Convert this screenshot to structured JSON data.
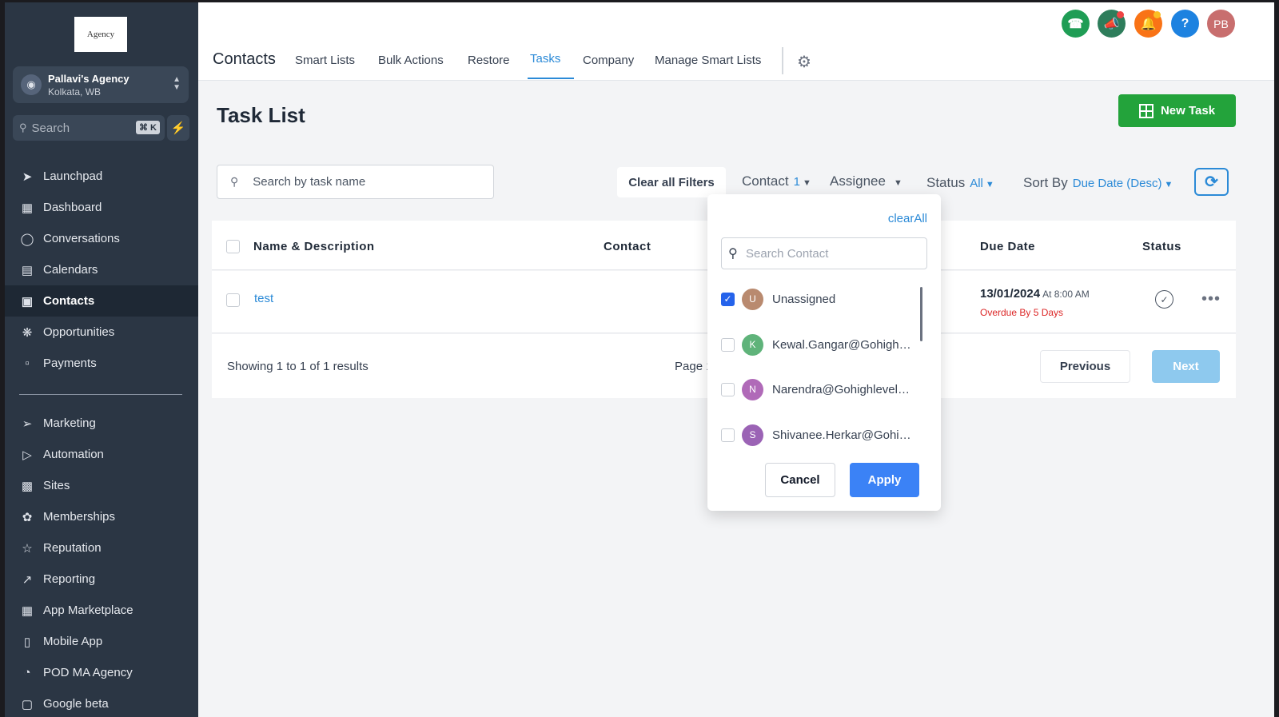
{
  "brand": {
    "logo_text": "Agency"
  },
  "account": {
    "name": "Pallavi's Agency",
    "location": "Kolkata, WB"
  },
  "sidebar_search": {
    "placeholder": "Search",
    "shortcut": "⌘ K"
  },
  "sidebar": {
    "items": [
      {
        "label": "Launchpad",
        "icon": "rocket-icon"
      },
      {
        "label": "Dashboard",
        "icon": "grid-icon"
      },
      {
        "label": "Conversations",
        "icon": "chat-icon"
      },
      {
        "label": "Calendars",
        "icon": "calendar-icon"
      },
      {
        "label": "Contacts",
        "icon": "contacts-icon",
        "active": true
      },
      {
        "label": "Opportunities",
        "icon": "opportunities-icon"
      },
      {
        "label": "Payments",
        "icon": "receipt-icon"
      },
      {
        "label": "Marketing",
        "icon": "send-icon"
      },
      {
        "label": "Automation",
        "icon": "automation-icon"
      },
      {
        "label": "Sites",
        "icon": "globe-icon"
      },
      {
        "label": "Memberships",
        "icon": "badge-icon"
      },
      {
        "label": "Reputation",
        "icon": "star-icon"
      },
      {
        "label": "Reporting",
        "icon": "trend-icon"
      },
      {
        "label": "App Marketplace",
        "icon": "apps-icon"
      },
      {
        "label": "Mobile App",
        "icon": "phone-icon"
      },
      {
        "label": "POD MA Agency",
        "icon": "pie-icon"
      },
      {
        "label": "Google beta",
        "icon": "google-icon"
      }
    ]
  },
  "header": {
    "title": "Contacts",
    "tabs": [
      {
        "label": "Smart Lists"
      },
      {
        "label": "Bulk Actions"
      },
      {
        "label": "Restore"
      },
      {
        "label": "Tasks",
        "active": true
      },
      {
        "label": "Company"
      },
      {
        "label": "Manage Smart Lists"
      }
    ],
    "avatar_initials": "PB",
    "help_glyph": "?",
    "colors": {
      "phone": "#1f9d55",
      "announce": "#2e7d5b",
      "bell": "#f97316",
      "help": "#1d82e0",
      "avatar": "#c86e6e"
    }
  },
  "page": {
    "title": "Task List",
    "new_task_label": "New Task"
  },
  "filters": {
    "search_placeholder": "Search by task name",
    "clear_all": "Clear all Filters",
    "contact_label": "Contact",
    "contact_count": "1",
    "assignee_label": "Assignee",
    "status_label": "Status",
    "status_value": "All",
    "sort_label": "Sort By",
    "sort_value": "Due Date (Desc)"
  },
  "table": {
    "columns": {
      "name": "Name & Description",
      "contact": "Contact",
      "due": "Due Date",
      "status": "Status"
    },
    "rows": [
      {
        "name": "test",
        "due_date": "13/01/2024",
        "due_time": "At 8:00 AM",
        "overdue": "Overdue By 5 Days"
      }
    ],
    "showing": "Showing 1 to 1 of 1 results",
    "page_label": "Page 1",
    "previous": "Previous",
    "next": "Next"
  },
  "dropdown": {
    "clear_all": "clearAll",
    "search_placeholder": "Search Contact",
    "options": [
      {
        "initial": "U",
        "label": "Unassigned",
        "checked": true,
        "color": "#b98a6f"
      },
      {
        "initial": "K",
        "label": "Kewal.Gangar@Gohighlevel.com",
        "checked": false,
        "color": "#5fb37a"
      },
      {
        "initial": "N",
        "label": "Narendra@Gohighlevel.com",
        "checked": false,
        "color": "#b06ab8"
      },
      {
        "initial": "S",
        "label": "Shivanee.Herkar@Gohighlevel.com",
        "checked": false,
        "color": "#9b63b5"
      }
    ],
    "cancel": "Cancel",
    "apply": "Apply"
  }
}
